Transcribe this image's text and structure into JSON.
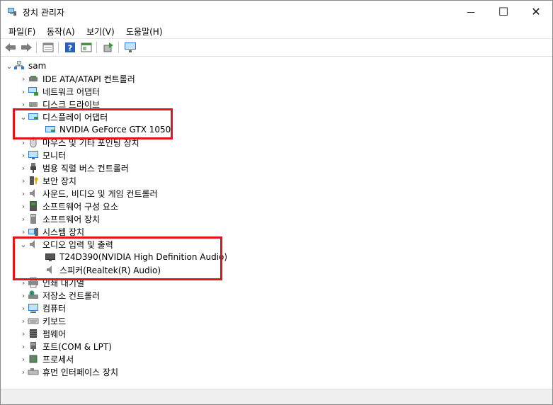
{
  "window": {
    "title": "장치 관리자",
    "minimize_glyph": "—",
    "maximize_glyph": "☐",
    "close_glyph": "✕"
  },
  "menu": [
    "파일(F)",
    "동작(A)",
    "보기(V)",
    "도움말(H)"
  ],
  "tree": {
    "root": "sam",
    "items": [
      {
        "label": "IDE ATA/ATAPI 컨트롤러",
        "icon": "ide-controller-icon"
      },
      {
        "label": "네트워크 어댑터",
        "icon": "network-adapter-icon"
      },
      {
        "label": "디스크 드라이브",
        "icon": "disk-drive-icon"
      },
      {
        "label": "디스플레이 어댑터",
        "icon": "display-adapter-icon",
        "expanded": true,
        "children": [
          {
            "label": "NVIDIA GeForce GTX 1050",
            "icon": "display-adapter-icon"
          }
        ]
      },
      {
        "label": "마우스 및 기타 포인팅 장치",
        "icon": "mouse-icon"
      },
      {
        "label": "모니터",
        "icon": "monitor-icon"
      },
      {
        "label": "범용 직렬 버스 컨트롤러",
        "icon": "usb-icon"
      },
      {
        "label": "보안 장치",
        "icon": "security-device-icon"
      },
      {
        "label": "사운드, 비디오 및 게임 컨트롤러",
        "icon": "speaker-icon"
      },
      {
        "label": "소프트웨어 구성 요소",
        "icon": "software-component-icon"
      },
      {
        "label": "소프트웨어 장치",
        "icon": "software-device-icon"
      },
      {
        "label": "시스템 장치",
        "icon": "system-device-icon"
      },
      {
        "label": "오디오 입력 및 출력",
        "icon": "speaker-icon",
        "expanded": true,
        "children": [
          {
            "label": "T24D390(NVIDIA High Definition Audio)",
            "icon": "monitor-dark-icon"
          },
          {
            "label": "스피커(Realtek(R) Audio)",
            "icon": "speaker-icon"
          }
        ]
      },
      {
        "label": "인쇄 대기열",
        "icon": "printer-icon"
      },
      {
        "label": "저장소 컨트롤러",
        "icon": "storage-controller-icon"
      },
      {
        "label": "컴퓨터",
        "icon": "computer-icon"
      },
      {
        "label": "키보드",
        "icon": "keyboard-icon"
      },
      {
        "label": "펌웨어",
        "icon": "firmware-icon"
      },
      {
        "label": "포트(COM & LPT)",
        "icon": "port-icon"
      },
      {
        "label": "프로세서",
        "icon": "processor-icon"
      },
      {
        "label": "휴먼 인터페이스 장치",
        "icon": "hid-icon"
      }
    ]
  },
  "colors": {
    "highlight": "#e0161b",
    "icon_blue": "#2b7bd3",
    "icon_green": "#3a9a3a"
  }
}
